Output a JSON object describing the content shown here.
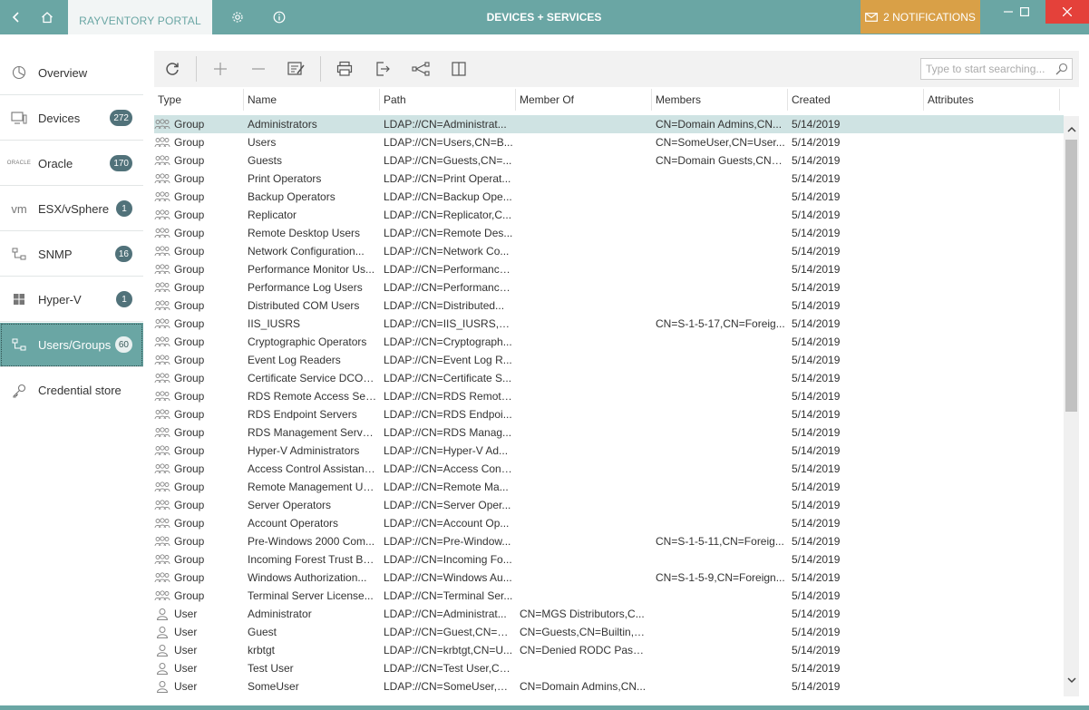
{
  "titlebar": {
    "tab_label": "RAYVENTORY PORTAL",
    "window_title": "DEVICES + SERVICES",
    "notifications_label": "2 NOTIFICATIONS",
    "accent_color": "#6aa6a4",
    "notification_color": "#d9a047",
    "close_color": "#e4413a"
  },
  "sidebar": {
    "items": [
      {
        "label": "Overview",
        "badge": "",
        "icon": "overview-icon"
      },
      {
        "label": "Devices",
        "badge": "272",
        "icon": "devices-icon"
      },
      {
        "label": "Oracle",
        "badge": "170",
        "icon": "oracle-icon",
        "icon_text": "ORACLE"
      },
      {
        "label": "ESX/vSphere",
        "badge": "1",
        "icon": "vm-icon",
        "icon_text": "vm"
      },
      {
        "label": "SNMP",
        "badge": "16",
        "icon": "network-icon"
      },
      {
        "label": "Hyper-V",
        "badge": "1",
        "icon": "windows-icon"
      },
      {
        "label": "Users/Groups",
        "badge": "60",
        "icon": "network-icon",
        "active": true
      },
      {
        "label": "Credential store",
        "badge": "",
        "icon": "key-icon"
      }
    ]
  },
  "search": {
    "placeholder": "Type to start searching..."
  },
  "columns": [
    "Type",
    "Name",
    "Path",
    "Member Of",
    "Members",
    "Created",
    "Attributes"
  ],
  "rows": [
    {
      "type": "Group",
      "name": "Administrators",
      "path": "LDAP://CN=Administrat...",
      "member_of": "",
      "members": "CN=Domain Admins,CN...",
      "created": "5/14/2019",
      "selected": true
    },
    {
      "type": "Group",
      "name": "Users",
      "path": "LDAP://CN=Users,CN=B...",
      "member_of": "",
      "members": "CN=SomeUser,CN=User...",
      "created": "5/14/2019"
    },
    {
      "type": "Group",
      "name": "Guests",
      "path": "LDAP://CN=Guests,CN=...",
      "member_of": "",
      "members": "CN=Domain Guests,CN=...",
      "created": "5/14/2019"
    },
    {
      "type": "Group",
      "name": "Print Operators",
      "path": "LDAP://CN=Print Operat...",
      "member_of": "",
      "members": "",
      "created": "5/14/2019"
    },
    {
      "type": "Group",
      "name": "Backup Operators",
      "path": "LDAP://CN=Backup Ope...",
      "member_of": "",
      "members": "",
      "created": "5/14/2019"
    },
    {
      "type": "Group",
      "name": "Replicator",
      "path": "LDAP://CN=Replicator,C...",
      "member_of": "",
      "members": "",
      "created": "5/14/2019"
    },
    {
      "type": "Group",
      "name": "Remote Desktop Users",
      "path": "LDAP://CN=Remote Des...",
      "member_of": "",
      "members": "",
      "created": "5/14/2019"
    },
    {
      "type": "Group",
      "name": "Network Configuration...",
      "path": "LDAP://CN=Network Co...",
      "member_of": "",
      "members": "",
      "created": "5/14/2019"
    },
    {
      "type": "Group",
      "name": "Performance Monitor Us...",
      "path": "LDAP://CN=Performance...",
      "member_of": "",
      "members": "",
      "created": "5/14/2019"
    },
    {
      "type": "Group",
      "name": "Performance Log Users",
      "path": "LDAP://CN=Performance...",
      "member_of": "",
      "members": "",
      "created": "5/14/2019"
    },
    {
      "type": "Group",
      "name": "Distributed COM Users",
      "path": "LDAP://CN=Distributed...",
      "member_of": "",
      "members": "",
      "created": "5/14/2019"
    },
    {
      "type": "Group",
      "name": "IIS_IUSRS",
      "path": "LDAP://CN=IIS_IUSRS,CN...",
      "member_of": "",
      "members": "CN=S-1-5-17,CN=Foreig...",
      "created": "5/14/2019"
    },
    {
      "type": "Group",
      "name": "Cryptographic Operators",
      "path": "LDAP://CN=Cryptograph...",
      "member_of": "",
      "members": "",
      "created": "5/14/2019"
    },
    {
      "type": "Group",
      "name": "Event Log Readers",
      "path": "LDAP://CN=Event Log R...",
      "member_of": "",
      "members": "",
      "created": "5/14/2019"
    },
    {
      "type": "Group",
      "name": "Certificate Service DCOM...",
      "path": "LDAP://CN=Certificate S...",
      "member_of": "",
      "members": "",
      "created": "5/14/2019"
    },
    {
      "type": "Group",
      "name": "RDS Remote Access Serv...",
      "path": "LDAP://CN=RDS Remote...",
      "member_of": "",
      "members": "",
      "created": "5/14/2019"
    },
    {
      "type": "Group",
      "name": "RDS Endpoint Servers",
      "path": "LDAP://CN=RDS Endpoi...",
      "member_of": "",
      "members": "",
      "created": "5/14/2019"
    },
    {
      "type": "Group",
      "name": "RDS Management Servers",
      "path": "LDAP://CN=RDS Manag...",
      "member_of": "",
      "members": "",
      "created": "5/14/2019"
    },
    {
      "type": "Group",
      "name": "Hyper-V Administrators",
      "path": "LDAP://CN=Hyper-V Ad...",
      "member_of": "",
      "members": "",
      "created": "5/14/2019"
    },
    {
      "type": "Group",
      "name": "Access Control Assistanc...",
      "path": "LDAP://CN=Access Contr...",
      "member_of": "",
      "members": "",
      "created": "5/14/2019"
    },
    {
      "type": "Group",
      "name": "Remote Management Us...",
      "path": "LDAP://CN=Remote Ma...",
      "member_of": "",
      "members": "",
      "created": "5/14/2019"
    },
    {
      "type": "Group",
      "name": "Server Operators",
      "path": "LDAP://CN=Server Oper...",
      "member_of": "",
      "members": "",
      "created": "5/14/2019"
    },
    {
      "type": "Group",
      "name": "Account Operators",
      "path": "LDAP://CN=Account Op...",
      "member_of": "",
      "members": "",
      "created": "5/14/2019"
    },
    {
      "type": "Group",
      "name": "Pre-Windows 2000 Com...",
      "path": "LDAP://CN=Pre-Window...",
      "member_of": "",
      "members": "CN=S-1-5-11,CN=Foreig...",
      "created": "5/14/2019"
    },
    {
      "type": "Group",
      "name": "Incoming Forest Trust Bu...",
      "path": "LDAP://CN=Incoming Fo...",
      "member_of": "",
      "members": "",
      "created": "5/14/2019"
    },
    {
      "type": "Group",
      "name": "Windows Authorization...",
      "path": "LDAP://CN=Windows Au...",
      "member_of": "",
      "members": "CN=S-1-5-9,CN=Foreign...",
      "created": "5/14/2019"
    },
    {
      "type": "Group",
      "name": "Terminal Server License...",
      "path": "LDAP://CN=Terminal Ser...",
      "member_of": "",
      "members": "",
      "created": "5/14/2019"
    },
    {
      "type": "User",
      "name": "Administrator",
      "path": "LDAP://CN=Administrat...",
      "member_of": "CN=MGS Distributors,C...",
      "members": "",
      "created": "5/14/2019"
    },
    {
      "type": "User",
      "name": "Guest",
      "path": "LDAP://CN=Guest,CN=U...",
      "member_of": "CN=Guests,CN=Builtin,D...",
      "members": "",
      "created": "5/14/2019"
    },
    {
      "type": "User",
      "name": "krbtgt",
      "path": "LDAP://CN=krbtgt,CN=U...",
      "member_of": "CN=Denied RODC Passw...",
      "members": "",
      "created": "5/14/2019"
    },
    {
      "type": "User",
      "name": "Test User",
      "path": "LDAP://CN=Test User,CN...",
      "member_of": "",
      "members": "",
      "created": "5/14/2019"
    },
    {
      "type": "User",
      "name": "SomeUser",
      "path": "LDAP://CN=SomeUser,C...",
      "member_of": "CN=Domain Admins,CN...",
      "members": "",
      "created": "5/14/2019"
    }
  ]
}
